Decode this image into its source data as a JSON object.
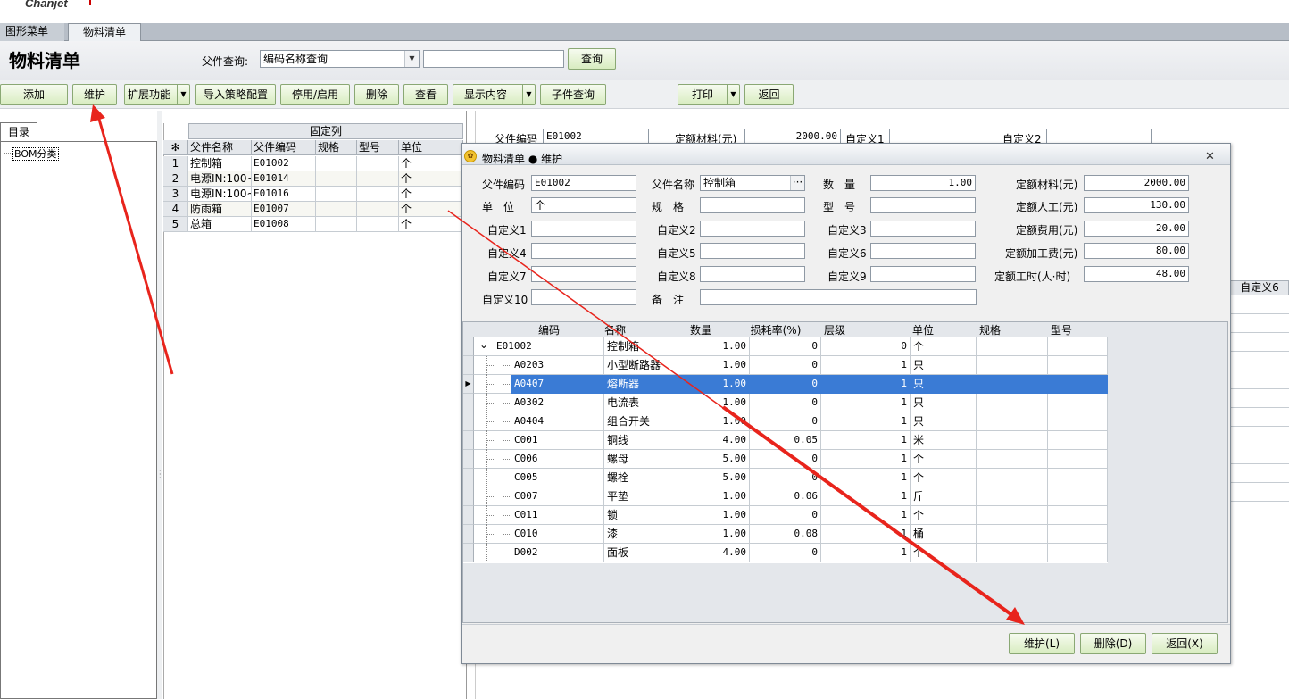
{
  "app": {
    "logo": "Chanjet"
  },
  "tabs": [
    {
      "label": "图形菜单",
      "active": false
    },
    {
      "label": "物料清单",
      "active": true
    }
  ],
  "header": {
    "title": "物料清单",
    "query_label": "父件查询:",
    "query_type": "编码名称查询",
    "query_value": "",
    "query_button": "查询"
  },
  "toolbar": {
    "add": "添加",
    "maintain": "维护",
    "extend": "扩展功能",
    "import": "导入策略配置",
    "toggle": "停用/启用",
    "delete": "删除",
    "view": "查看",
    "display": "显示内容",
    "child_query": "子件查询",
    "print": "打印",
    "back": "返回"
  },
  "left": {
    "tab": "目录",
    "tree_node": "BOM分类"
  },
  "grid": {
    "group_header": "固定列",
    "columns": [
      "父件名称",
      "父件编码",
      "规格",
      "型号",
      "单位"
    ],
    "rows": [
      {
        "n": "1",
        "name": "控制箱",
        "code": "E01002",
        "unit": "个"
      },
      {
        "n": "2",
        "name": "电源IN:100~",
        "code": "E01014",
        "unit": "个"
      },
      {
        "n": "3",
        "name": "电源IN:100~",
        "code": "E01016",
        "unit": "个"
      },
      {
        "n": "4",
        "name": "防雨箱",
        "code": "E01007",
        "unit": "个"
      },
      {
        "n": "5",
        "name": "总箱",
        "code": "E01008",
        "unit": "个"
      }
    ]
  },
  "behind_form": {
    "parent_code_label": "父件编码",
    "parent_code": "E01002",
    "material_label": "定额材料(元)",
    "material": "2000.00",
    "custom1_label": "自定义1",
    "custom2_label": "自定义2",
    "custom6_label": "自定义6"
  },
  "dialog": {
    "title": "物料清单 ● 维护",
    "form": {
      "parent_code_label": "父件编码",
      "parent_code": "E01002",
      "parent_name_label": "父件名称",
      "parent_name": "控制箱",
      "qty_label": "数　量",
      "qty": "1.00",
      "material_label": "定额材料(元)",
      "material": "2000.00",
      "unit_label": "单　位",
      "unit": "个",
      "spec_label": "规　格",
      "spec": "",
      "model_label": "型　号",
      "model": "",
      "labor_label": "定额人工(元)",
      "labor": "130.00",
      "c1_label": "自定义1",
      "c2_label": "自定义2",
      "c3_label": "自定义3",
      "fee_label": "定额费用(元)",
      "fee": "20.00",
      "c4_label": "自定义4",
      "c5_label": "自定义5",
      "c6_label": "自定义6",
      "proc_label": "定额加工费(元)",
      "proc": "80.00",
      "c7_label": "自定义7",
      "c8_label": "自定义8",
      "c9_label": "自定义9",
      "hours_label": "定额工时(人·时)",
      "hours": "48.00",
      "c10_label": "自定义10",
      "remark_label": "备　注",
      "remark": ""
    },
    "tree_columns": [
      "编码",
      "名称",
      "数量",
      "损耗率(%)",
      "层级",
      "单位",
      "规格",
      "型号"
    ],
    "tree_rows": [
      {
        "code": "E01002",
        "name": "控制箱",
        "qty": "1.00",
        "loss": "0",
        "level": "0",
        "unit": "个",
        "root": true
      },
      {
        "code": "A0203",
        "name": "小型断路器",
        "qty": "1.00",
        "loss": "0",
        "level": "1",
        "unit": "只"
      },
      {
        "code": "A0407",
        "name": "熔断器",
        "qty": "1.00",
        "loss": "0",
        "level": "1",
        "unit": "只",
        "selected": true
      },
      {
        "code": "A0302",
        "name": "电流表",
        "qty": "1.00",
        "loss": "0",
        "level": "1",
        "unit": "只"
      },
      {
        "code": "A0404",
        "name": "组合开关",
        "qty": "1.00",
        "loss": "0",
        "level": "1",
        "unit": "只"
      },
      {
        "code": "C001",
        "name": "铜线",
        "qty": "4.00",
        "loss": "0.05",
        "level": "1",
        "unit": "米"
      },
      {
        "code": "C006",
        "name": "螺母",
        "qty": "5.00",
        "loss": "0",
        "level": "1",
        "unit": "个"
      },
      {
        "code": "C005",
        "name": "螺栓",
        "qty": "5.00",
        "loss": "0",
        "level": "1",
        "unit": "个"
      },
      {
        "code": "C007",
        "name": "平垫",
        "qty": "1.00",
        "loss": "0.06",
        "level": "1",
        "unit": "斤"
      },
      {
        "code": "C011",
        "name": "锁",
        "qty": "1.00",
        "loss": "0",
        "level": "1",
        "unit": "个"
      },
      {
        "code": "C010",
        "name": "漆",
        "qty": "1.00",
        "loss": "0.08",
        "level": "1",
        "unit": "桶"
      },
      {
        "code": "D002",
        "name": "面板",
        "qty": "4.00",
        "loss": "0",
        "level": "1",
        "unit": "个"
      }
    ],
    "buttons": {
      "maintain": "维护(L)",
      "delete": "删除(D)",
      "back": "返回(X)"
    }
  },
  "colors": {
    "accent_button": "#d8ecc0",
    "selection": "#3a7bd5",
    "annotation": "#e8241c"
  }
}
